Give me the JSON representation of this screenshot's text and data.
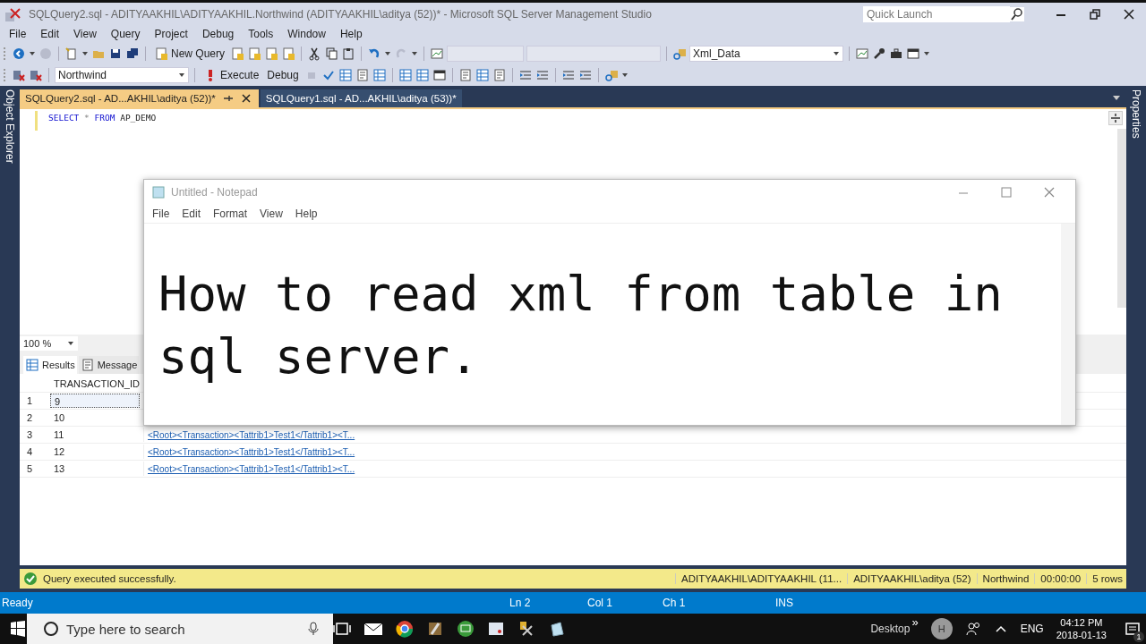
{
  "window": {
    "title": "SQLQuery2.sql - ADITYAAKHIL\\ADITYAAKHIL.Northwind (ADITYAAKHIL\\aditya (52))* - Microsoft SQL Server Management Studio",
    "quick_launch": {
      "placeholder": "Quick Launch"
    }
  },
  "menu": [
    "File",
    "Edit",
    "View",
    "Query",
    "Project",
    "Debug",
    "Tools",
    "Window",
    "Help"
  ],
  "toolbar": {
    "new_query": "New Query",
    "solution_combo": "Xml_Data",
    "database_combo": "Northwind",
    "execute": "Execute",
    "debug": "Debug"
  },
  "side_panels": {
    "left": "Object Explorer",
    "right": "Properties"
  },
  "doc_tabs": [
    {
      "label": "SQLQuery2.sql - AD...AKHIL\\aditya (52))*",
      "selected": true
    },
    {
      "label": "SQLQuery1.sql - AD...AKHIL\\aditya (53))*",
      "selected": false
    }
  ],
  "editor": {
    "lines": [
      [
        {
          "text": "SELECT",
          "kind": "keyword"
        },
        {
          "text": "*",
          "kind": "operator"
        },
        {
          "text": "FROM",
          "kind": "keyword"
        },
        {
          "text": "AP_DEMO",
          "kind": "plain"
        }
      ]
    ]
  },
  "zoom": "100 %",
  "result_tabs": [
    {
      "label": "Results",
      "selected": true
    },
    {
      "label": "Message",
      "selected": false
    }
  ],
  "grid": {
    "columns": [
      "TRANSACTION_ID"
    ],
    "rows": [
      {
        "num": "1",
        "id": "9",
        "selected": true
      },
      {
        "num": "2",
        "id": "10",
        "selected": false
      },
      {
        "num": "3",
        "id": "11",
        "xml": "<Root><Transaction><Tattrib1>Test1</Tattrib1><T...",
        "selected": false
      },
      {
        "num": "4",
        "id": "12",
        "xml": "<Root><Transaction><Tattrib1>Test1</Tattrib1><T...",
        "selected": false
      },
      {
        "num": "5",
        "id": "13",
        "xml": "<Root><Transaction><Tattrib1>Test1</Tattrib1><T...",
        "selected": false
      }
    ]
  },
  "query_status": {
    "message": "Query executed successfully.",
    "segments": [
      "ADITYAAKHIL\\ADITYAAKHIL (11...",
      "ADITYAAKHIL\\aditya (52)",
      "Northwind",
      "00:00:00",
      "5 rows"
    ]
  },
  "status_bar": {
    "state": "Ready",
    "line": "Ln 2",
    "col": "Col 1",
    "ch": "Ch 1",
    "mode": "INS"
  },
  "notepad": {
    "title": "Untitled - Notepad",
    "menu": [
      "File",
      "Edit",
      "Format",
      "View",
      "Help"
    ],
    "text": "How to read xml from table in sql server."
  },
  "taskbar": {
    "search_placeholder": "Type here to search",
    "desktop": "Desktop",
    "chevron": "»",
    "user_initial": "H",
    "language": "ENG",
    "time": "04:12 PM",
    "date": "2018-01-13",
    "notifications": "1"
  }
}
